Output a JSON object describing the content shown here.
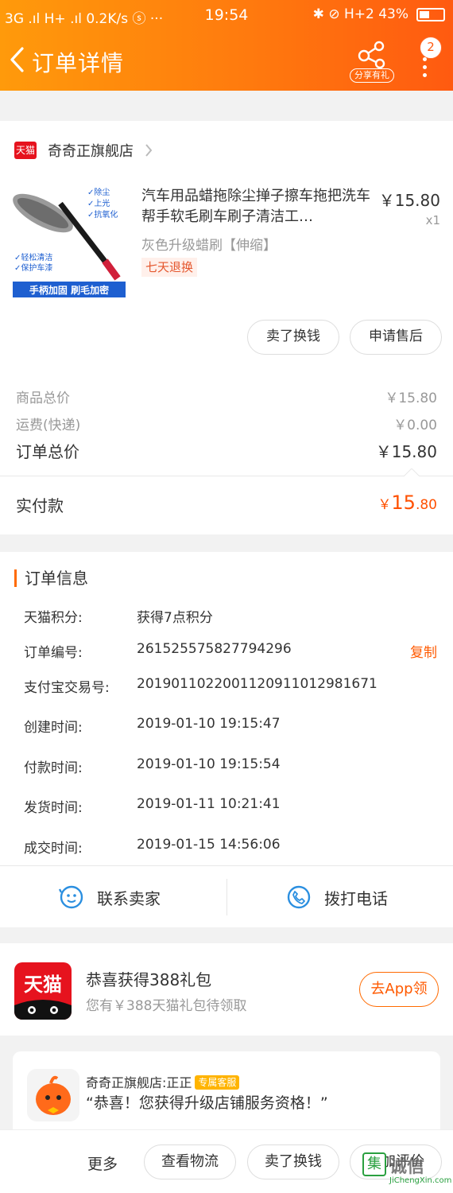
{
  "status_bar": {
    "left": "3G .ıl H+ .ıl 0.2K/s ⓢ ···",
    "time": "19:54",
    "right": "✱ ⊘ H+2 43%"
  },
  "nav": {
    "title": "订单详情",
    "share_label": "分享有礼",
    "more_badge": "2"
  },
  "shop": {
    "platform_tag": "天猫",
    "name": "奇奇正旗舰店"
  },
  "product": {
    "title": "汽车用品蜡拖除尘掸子擦车拖把洗车帮手软毛刷车刷子清洁工…",
    "price": "￥15.80",
    "qty": "x1",
    "sku": "灰色升级蜡刷【伸缩】",
    "tag": "七天退换",
    "image_text": {
      "bullets": [
        "✓除尘",
        "✓上光",
        "✓抗氧化"
      ],
      "bullets2": [
        "✓轻松清洁",
        "✓保护车漆"
      ],
      "banner": "手柄加固 刷毛加密"
    }
  },
  "product_actions": {
    "sell": "卖了换钱",
    "after_sale": "申请售后"
  },
  "summary": {
    "goods_label": "商品总价",
    "goods_value": "￥15.80",
    "shipping_label": "运费(快递)",
    "shipping_value": "￥0.00",
    "total_label": "订单总价",
    "total_value": "￥15.80",
    "paid_label": "实付款",
    "paid_currency": "￥",
    "paid_int": "15",
    "paid_dec": ".80"
  },
  "order_info": {
    "title": "订单信息",
    "rows": [
      {
        "k": "天猫积分:",
        "v": "获得7点积分"
      },
      {
        "k": "订单编号:",
        "v": "261525575827794296",
        "action": "复制"
      },
      {
        "k": "支付宝交易号:",
        "v": "2019011022001120911012981671"
      },
      {
        "k": "创建时间:",
        "v": "2019-01-10 19:15:47"
      },
      {
        "k": "付款时间:",
        "v": "2019-01-10 19:15:54"
      },
      {
        "k": "发货时间:",
        "v": "2019-01-11 10:21:41"
      },
      {
        "k": "成交时间:",
        "v": "2019-01-15 14:56:06"
      }
    ]
  },
  "contact": {
    "seller": "联系卖家",
    "phone": "拨打电话"
  },
  "gift": {
    "logo_text": "天猫",
    "title": "恭喜获得388礼包",
    "subtitle": "您有￥388天猫礼包待领取",
    "button": "去App领"
  },
  "chat": {
    "name": "奇奇正旗舰店:正正",
    "badge": "专属客服",
    "message": "“恭喜！您获得升级店铺服务资格！”"
  },
  "bottom_bar": {
    "more": "更多",
    "logistics": "查看物流",
    "sell": "卖了换钱",
    "review": "追加评价"
  },
  "watermark": {
    "box": "集",
    "text": "诚信",
    "sub": "JiChengXin.com"
  },
  "colors": {
    "accent": "#ff5a00",
    "tmall_red": "#e6131e",
    "header_gradient_start": "#ff9a0b",
    "header_gradient_end": "#ff5a10"
  }
}
